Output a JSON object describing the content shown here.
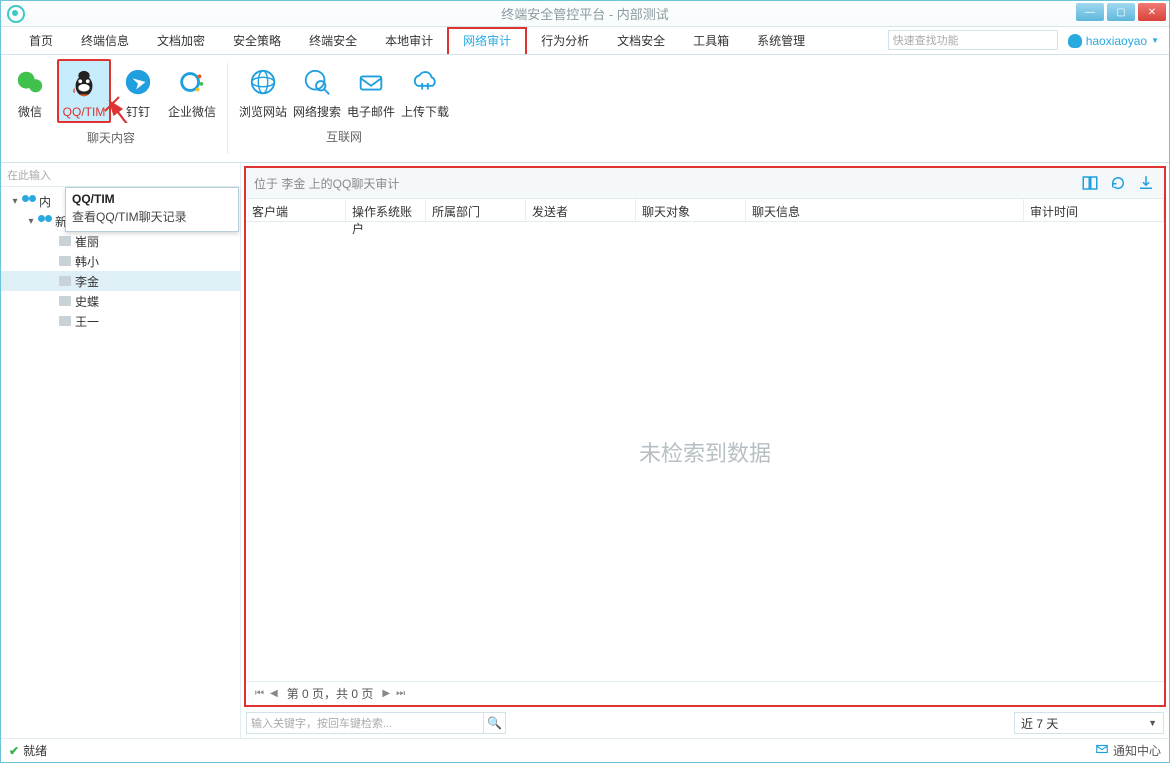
{
  "title": "终端安全管控平台 - 内部测试",
  "menu": {
    "items": [
      "首页",
      "终端信息",
      "文档加密",
      "安全策略",
      "终端安全",
      "本地审计",
      "网络审计",
      "行为分析",
      "文档安全",
      "工具箱",
      "系统管理"
    ],
    "active_index": 6,
    "search_placeholder": "快速查找功能",
    "user": "haoxiaoyao"
  },
  "ribbon": {
    "group1_label": "聊天内容",
    "group2_label": "互联网",
    "items": [
      "微信",
      "QQ/TIM",
      "钉钉",
      "企业微信",
      "浏览网站",
      "网络搜索",
      "电子邮件",
      "上传下载"
    ],
    "selected_index": 1
  },
  "tooltip": {
    "title": "QQ/TIM",
    "body": "查看QQ/TIM聊天记录"
  },
  "tree": {
    "search_placeholder": "在此输入",
    "root": "内",
    "group": "新媒体一部 (0/5)",
    "leaves": [
      "崔丽",
      "韩小",
      "李金",
      "史蝶",
      "王一"
    ],
    "selected_leaf_index": 2
  },
  "audit": {
    "header": "位于 李金 上的QQ聊天审计",
    "columns": [
      "客户端",
      "操作系统账户",
      "所属部门",
      "发送者",
      "聊天对象",
      "聊天信息",
      "审计时间"
    ],
    "empty_text": "未检索到数据",
    "pager": "第 0 页，共 0 页"
  },
  "filter": {
    "kw_placeholder": "输入关键字，按回车键检索...",
    "range": "近 7 天"
  },
  "status": {
    "text": "就绪",
    "notification": "通知中心"
  }
}
